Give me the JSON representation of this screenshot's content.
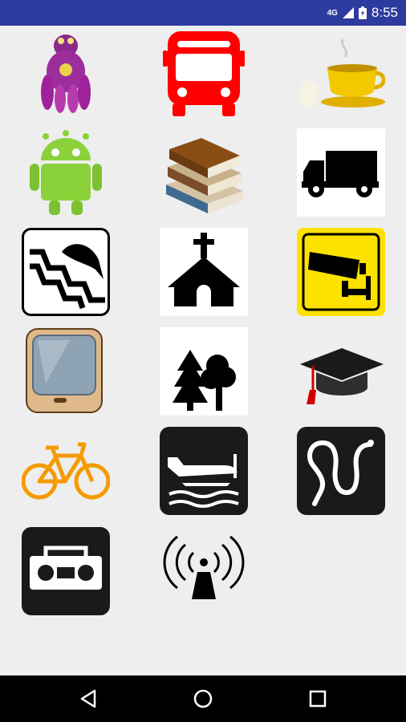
{
  "status_bar": {
    "network": "4G",
    "time": "8:55"
  },
  "icons": [
    {
      "name": "alien-robot-icon"
    },
    {
      "name": "bus-icon"
    },
    {
      "name": "coffee-cup-icon"
    },
    {
      "name": "android-robot-icon"
    },
    {
      "name": "books-icon"
    },
    {
      "name": "truck-icon"
    },
    {
      "name": "fish-ladder-icon"
    },
    {
      "name": "church-icon"
    },
    {
      "name": "surveillance-camera-icon"
    },
    {
      "name": "tv-icon"
    },
    {
      "name": "trees-icon"
    },
    {
      "name": "graduation-cap-icon"
    },
    {
      "name": "bicycle-icon"
    },
    {
      "name": "seaplane-icon"
    },
    {
      "name": "snake-icon"
    },
    {
      "name": "radio-icon"
    },
    {
      "name": "antenna-icon"
    }
  ],
  "navigation": {
    "back": "back-icon",
    "home": "home-icon",
    "recents": "recents-icon"
  },
  "colors": {
    "status_bar": "#2d3a9e",
    "background": "#eeeeee",
    "nav_bar": "#000000"
  }
}
